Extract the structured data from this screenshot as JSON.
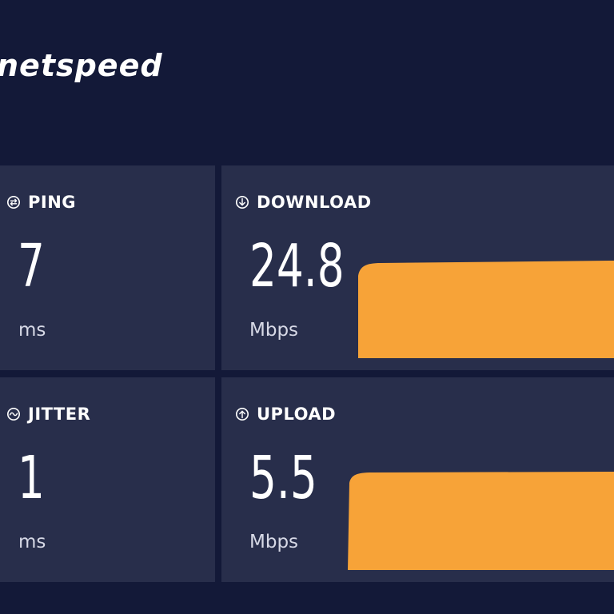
{
  "app": {
    "brand": "netspeed"
  },
  "metrics": {
    "ping": {
      "label": "PING",
      "value": "7",
      "unit": "ms",
      "icon": "ping-icon"
    },
    "jitter": {
      "label": "JITTER",
      "value": "1",
      "unit": "ms",
      "icon": "jitter-icon"
    },
    "download": {
      "label": "DOWNLOAD",
      "value": "24.8",
      "unit": "Mbps",
      "icon": "download-icon"
    },
    "upload": {
      "label": "UPLOAD",
      "value": "5.5",
      "unit": "Mbps",
      "icon": "upload-icon"
    }
  },
  "colors": {
    "background": "#131938",
    "card": "#282e4b",
    "graph": "#f7a338",
    "text": "#ffffff"
  }
}
